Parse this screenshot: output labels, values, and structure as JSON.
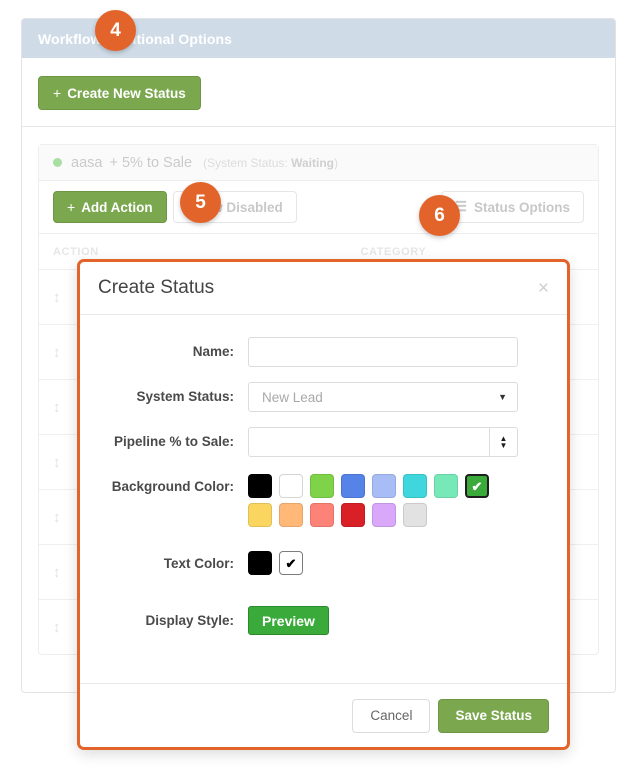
{
  "panel": {
    "heading": "Workflow Additional Options",
    "create_new_status_label": "Create New Status",
    "plus_glyph": "+"
  },
  "status_block": {
    "name": "aasa",
    "pipeline": "+ 5% to Sale",
    "system_status_note": "(System Status: Waiting)",
    "system_status_prefix": "(System Status: ",
    "system_status_value": "Waiting",
    "system_status_suffix": ")",
    "add_action_label": "Add Action",
    "show_disabled_label": "Show Disabled",
    "status_options_label": "Status Options",
    "hamburger_glyph": "☰",
    "table": {
      "columns": [
        "ACTION",
        "CATEGORY"
      ],
      "rows": [
        {
          "handle": "↕"
        },
        {
          "handle": "↕"
        },
        {
          "handle": "↕"
        },
        {
          "handle": "↕"
        },
        {
          "handle": "↕"
        },
        {
          "handle": "↕"
        },
        {
          "handle": "↕"
        }
      ]
    }
  },
  "modal": {
    "title": "Create Status",
    "close_glyph": "×",
    "fields": {
      "name": {
        "label": "Name:",
        "value": "",
        "placeholder": ""
      },
      "system_status": {
        "label": "System Status:",
        "value": "New Lead",
        "options": [
          "New Lead"
        ],
        "caret_glyph": "▼"
      },
      "pipeline_pct": {
        "label": "Pipeline % to Sale:",
        "value": "",
        "placeholder": "",
        "spinner_up_glyph": "▲",
        "spinner_down_glyph": "▼"
      },
      "background_color": {
        "label": "Background Color:",
        "selected_index": 7,
        "check_glyph": "✔",
        "swatches": [
          "#000000",
          "#ffffff",
          "#7ed348",
          "#5583e8",
          "#a8bdf6",
          "#3fd6dd",
          "#77e9b9",
          "#3aaa3a",
          "#fad660",
          "#ffb878",
          "#fd8277",
          "#d92027",
          "#d9a8fb",
          "#e2e2e2"
        ]
      },
      "text_color": {
        "label": "Text Color:",
        "selected_index": 1,
        "check_glyph": "✔",
        "swatches": [
          "#000000",
          "#ffffff"
        ]
      },
      "display_style": {
        "label": "Display Style:",
        "preview_label": "Preview",
        "preview_bg": "#3aaa3a",
        "preview_fg": "#ffffff"
      }
    },
    "footer": {
      "cancel_label": "Cancel",
      "save_label": "Save Status"
    }
  },
  "callouts": [
    {
      "number": "4"
    },
    {
      "number": "5"
    },
    {
      "number": "6"
    }
  ],
  "colors": {
    "accent_orange": "#e2642a",
    "green_button": "#7ba84f",
    "header_blue": "#cfdce8"
  }
}
